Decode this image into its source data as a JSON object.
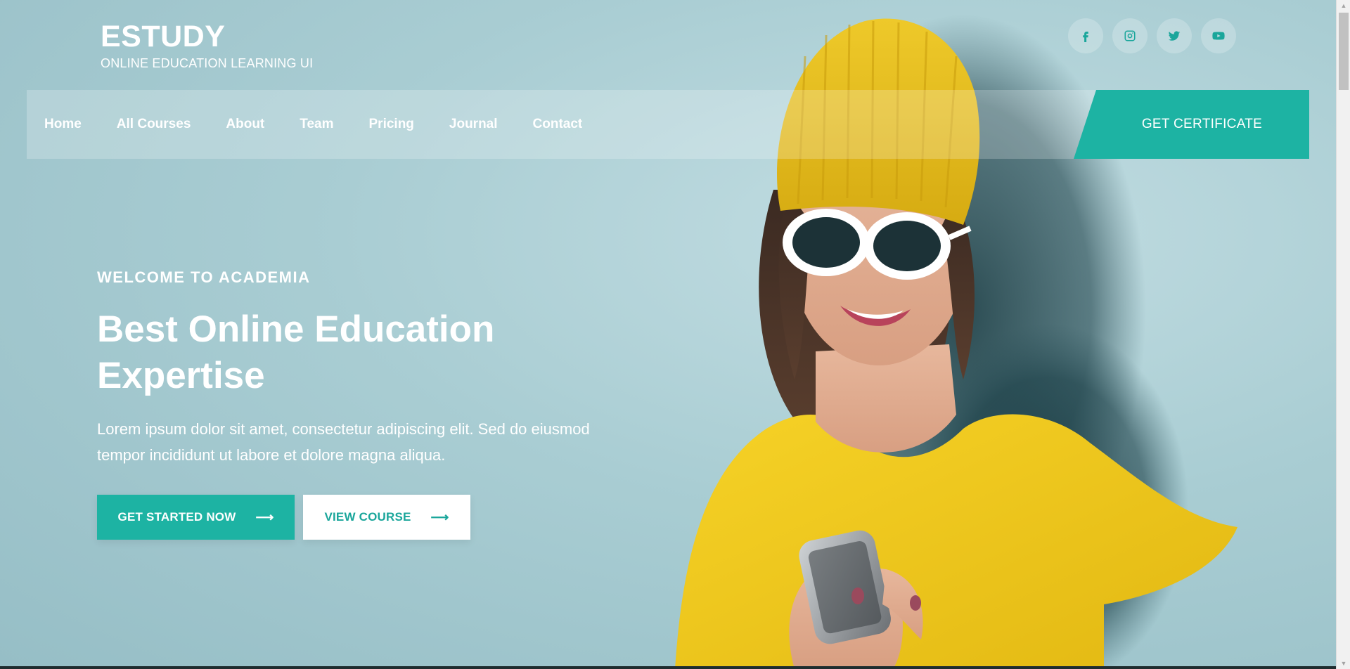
{
  "brand": {
    "title": "ESTUDY",
    "subtitle": "ONLINE EDUCATION LEARNING UI"
  },
  "social": [
    {
      "name": "facebook",
      "icon": "facebook-icon"
    },
    {
      "name": "instagram",
      "icon": "instagram-icon"
    },
    {
      "name": "twitter",
      "icon": "twitter-icon"
    },
    {
      "name": "youtube",
      "icon": "youtube-icon"
    }
  ],
  "nav": {
    "items": [
      "Home",
      "All Courses",
      "About",
      "Team",
      "Pricing",
      "Journal",
      "Contact"
    ],
    "cta": "GET CERTIFICATE"
  },
  "hero": {
    "kicker": "WELCOME TO ACADEMIA",
    "headline": "Best Online Education Expertise",
    "lead": "Lorem ipsum dolor sit amet, consectetur adipiscing elit. Sed do eiusmod tempor incididunt ut labore et dolore magna aliqua.",
    "primary_button": "GET STARTED NOW",
    "secondary_button": "VIEW COURSE",
    "arrow_glyph": "⟶"
  },
  "colors": {
    "accent": "#1db3a3",
    "background": "#a7ccd2",
    "hat": "#e8c21a",
    "shirt": "#f2c91c"
  }
}
